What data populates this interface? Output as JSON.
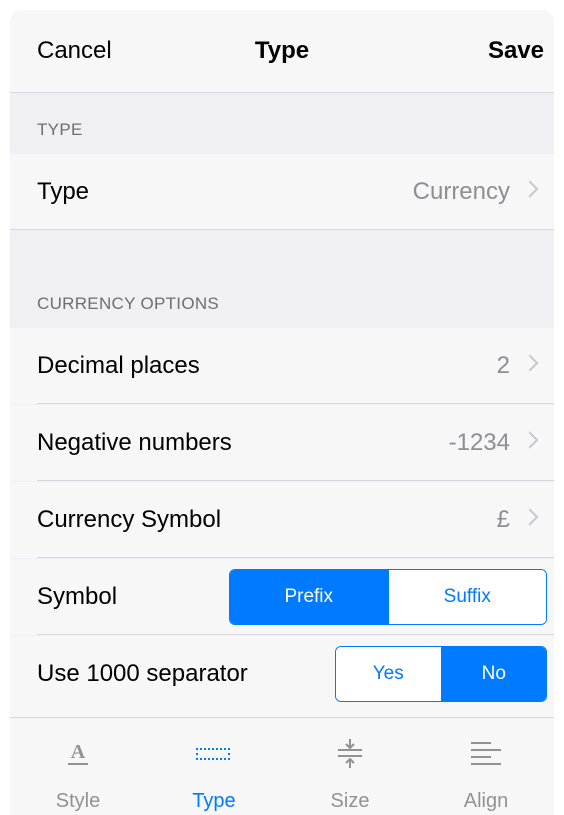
{
  "navbar": {
    "cancel": "Cancel",
    "title": "Type",
    "save": "Save"
  },
  "sections": {
    "type_header": "TYPE",
    "currency_header": "CURRENCY OPTIONS"
  },
  "rows": {
    "type": {
      "label": "Type",
      "value": "Currency"
    },
    "decimal": {
      "label": "Decimal places",
      "value": "2"
    },
    "negative": {
      "label": "Negative numbers",
      "value": "-1234"
    },
    "currency_symbol": {
      "label": "Currency Symbol",
      "value": "£"
    },
    "symbol": {
      "label": "Symbol",
      "options": [
        "Prefix",
        "Suffix"
      ],
      "selected": "Prefix"
    },
    "separator": {
      "label": "Use 1000 separator",
      "options": [
        "Yes",
        "No"
      ],
      "selected": "No"
    }
  },
  "tabs": [
    {
      "label": "Style",
      "icon": "style-icon",
      "active": false
    },
    {
      "label": "Type",
      "icon": "type-icon",
      "active": true
    },
    {
      "label": "Size",
      "icon": "size-icon",
      "active": false
    },
    {
      "label": "Align",
      "icon": "align-icon",
      "active": false
    }
  ],
  "colors": {
    "accent": "#007aff",
    "secondary_text": "#8e8e93",
    "background": "#efeff4"
  }
}
